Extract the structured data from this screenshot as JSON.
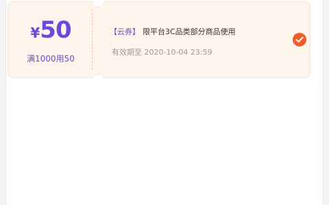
{
  "coupon": {
    "currency": "¥",
    "amount": "50",
    "threshold": "满1000用50",
    "tag": "【云券】",
    "description": "限平台3C品类部分商品使用",
    "expiry": "有效期至 2020-10-04 23:59",
    "selected": true
  },
  "colors": {
    "accent": "#6a4ad8",
    "check": "#ef5d2a",
    "coupon_bg": "#fdf4ec"
  }
}
